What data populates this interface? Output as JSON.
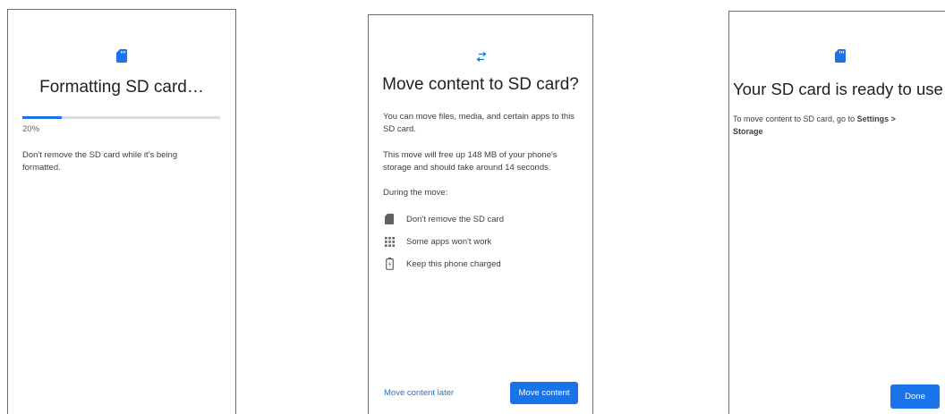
{
  "colors": {
    "accent": "#1a73e8",
    "text_primary": "#202124",
    "text_secondary": "#3c4043",
    "progress_track": "#dadce0"
  },
  "screen_format": {
    "icon": "sd-card-icon",
    "title": "Formatting SD card…",
    "progress": 0.2,
    "progress_label": "20%",
    "message": "Don't remove the SD card while it's being formatted."
  },
  "screen_move": {
    "icon": "transfer-arrows-icon",
    "title": "Move content to SD card?",
    "intro": "You can move files, media, and certain apps to this SD card.",
    "free_up": "This move will free up 148 MB of your phone's storage and should take around 14 seconds.",
    "during_label": "During the move:",
    "items": [
      {
        "icon": "sd-card-icon",
        "label": "Don't remove the SD card"
      },
      {
        "icon": "apps-grid-icon",
        "label": "Some apps won't work"
      },
      {
        "icon": "battery-charging-icon",
        "label": "Keep this phone charged"
      }
    ],
    "later_button": "Move content later",
    "move_button": "Move content"
  },
  "screen_ready": {
    "icon": "sd-card-icon",
    "title": "Your SD card is ready to use",
    "message_prefix": "To move content to SD card, go to ",
    "message_bold": "Settings > Storage",
    "done_button": "Done"
  }
}
